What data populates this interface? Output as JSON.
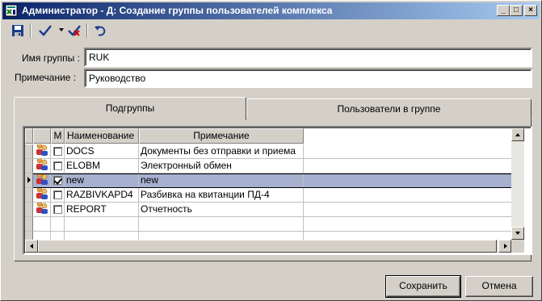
{
  "window": {
    "title": "Администратор - Д: Создание группы пользователей комплекса",
    "controls": {
      "minimize": "_",
      "maximize": "□",
      "close": "×"
    }
  },
  "toolbar": {
    "items": [
      "save-icon",
      "apply-check-icon",
      "dropdown-arrow-icon",
      "cancel-check-icon",
      "undo-icon"
    ]
  },
  "form": {
    "group_name_label": "Имя группы :",
    "group_name_value": "RUK",
    "note_label": "Примечание :",
    "note_value": "Руководство"
  },
  "tabs": [
    {
      "label": "Подгруппы",
      "active": true
    },
    {
      "label": "Пользователи в группе",
      "active": false
    }
  ],
  "grid": {
    "columns": {
      "m": "М",
      "name": "Наименование",
      "note": "Примечание"
    },
    "rows": [
      {
        "checked": false,
        "name": "DOCS",
        "note": "Документы без отправки и приема",
        "selected": false
      },
      {
        "checked": false,
        "name": "ELOBM",
        "note": "Электронный обмен",
        "selected": false
      },
      {
        "checked": true,
        "name": "new",
        "note": "new",
        "selected": true
      },
      {
        "checked": false,
        "name": "RAZBIVKAPD4",
        "note": "Разбивка на квитанции ПД-4",
        "selected": false
      },
      {
        "checked": false,
        "name": "REPORT",
        "note": "Отчетность",
        "selected": false
      }
    ]
  },
  "buttons": {
    "save": "Сохранить",
    "cancel": "Отмена"
  },
  "colors": {
    "title_gradient_start": "#0a246a",
    "title_gradient_end": "#a6caf0",
    "selection": "#a8b0d0",
    "face": "#d4d0c8"
  }
}
